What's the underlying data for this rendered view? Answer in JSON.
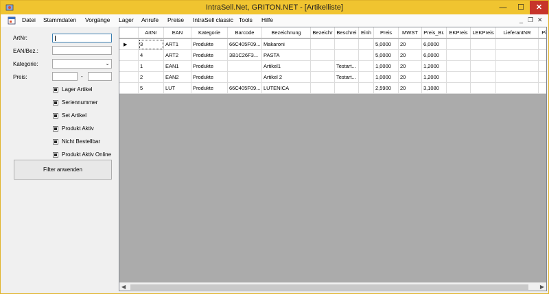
{
  "window": {
    "title": "IntraSell.Net, GRITON.NET - [Artikelliste]",
    "min": "—",
    "max": "☐",
    "close": "✕"
  },
  "menu": {
    "items": [
      "Datei",
      "Stammdaten",
      "Vorgänge",
      "Lager",
      "Anrufe",
      "Preise",
      "IntraSell classic",
      "Tools",
      "Hilfe"
    ],
    "mdi_min": "_",
    "mdi_restore": "❐",
    "mdi_close": "✕"
  },
  "filter": {
    "artnr_label": "ArtNr:",
    "ean_label": "EAN/Bez.:",
    "kategorie_label": "Kategorie:",
    "preis_label": "Preis:",
    "preis_sep": "-",
    "checkboxes": [
      {
        "label": "Lager Artikel",
        "checked": true
      },
      {
        "label": "Seriennummer",
        "checked": true
      },
      {
        "label": "Set Artikel",
        "checked": true
      },
      {
        "label": "Produkt Aktiv",
        "checked": true
      },
      {
        "label": "Nicht Bestellbar",
        "checked": true
      },
      {
        "label": "Produkt Aktiv Online",
        "checked": true
      }
    ],
    "apply_button": "Filter anwenden"
  },
  "grid": {
    "columns": [
      "ArtNr",
      "EAN",
      "Kategorie",
      "Barcode",
      "Bezeichnung",
      "Bezeichr",
      "Beschrei",
      "Einh",
      "Preis",
      "MWST",
      "Preis_Br.",
      "EKPreis",
      "LEKPreis",
      "LieferantNR",
      "Pic"
    ],
    "rows": [
      [
        "3",
        "ART1",
        "Produkte",
        "66C405F09...",
        "Makaroni",
        "",
        "",
        "",
        "5,0000",
        "20",
        "6,0000",
        "",
        "",
        "",
        ""
      ],
      [
        "4",
        "ART2",
        "Produkte",
        "3B1C26F3...",
        "PASTA",
        "",
        "",
        "",
        "5,0000",
        "20",
        "6,0000",
        "",
        "",
        "",
        ""
      ],
      [
        "1",
        "EAN1",
        "Produkte",
        "",
        "Artikel1",
        "",
        "Testart...",
        "",
        "1,0000",
        "20",
        "1,2000",
        "",
        "",
        "",
        ""
      ],
      [
        "2",
        "EAN2",
        "Produkte",
        "",
        "Artikel 2",
        "",
        "Testart...",
        "",
        "1,0000",
        "20",
        "1,2000",
        "",
        "",
        "",
        ""
      ],
      [
        "5",
        "LUT",
        "Produkte",
        "66C405F09...",
        "LUTENICA",
        "",
        "",
        "",
        "2,5900",
        "20",
        "3,1080",
        "",
        "",
        "",
        ""
      ]
    ],
    "current_row_marker": "▶"
  },
  "colors": {
    "titlebar": "#f0c430",
    "close_button": "#c7342a",
    "grid_background": "#ababab"
  }
}
